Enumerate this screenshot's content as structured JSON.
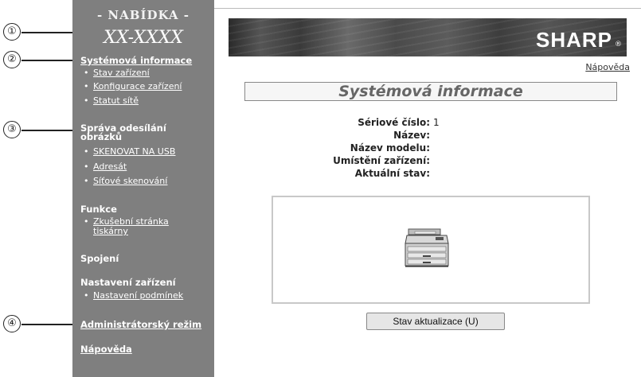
{
  "callouts": [
    "①",
    "②",
    "③",
    "④"
  ],
  "sidebar": {
    "menu_title": "- NABÍDKA -",
    "model": "XX-XXXX",
    "sections": [
      {
        "label": "Systémová informace",
        "items": [
          "Stav zařízení",
          "Konfigurace zařízení",
          "Statut sítě"
        ]
      },
      {
        "label_line1": "Správa odesílání",
        "label_line2": "obrázků",
        "items": [
          "SKENOVAT NA USB",
          "Adresát",
          "Síťové skenování"
        ]
      },
      {
        "label": "Funkce",
        "items_line1": "Zkušební stránka",
        "items_line2": "tiskárny"
      },
      {
        "label": "Spojení"
      },
      {
        "label": "Nastavení zařízení",
        "items": [
          "Nastavení podmínek"
        ]
      },
      {
        "label": "Administrátorský režim"
      },
      {
        "label": "Nápověda"
      }
    ]
  },
  "header": {
    "logo": "SHARP",
    "help_link": "Nápověda"
  },
  "main": {
    "title": "Systémová informace",
    "info": [
      {
        "label": "Sériové číslo:",
        "value": "1"
      },
      {
        "label": "Název:",
        "value": ""
      },
      {
        "label": "Název modelu:",
        "value": ""
      },
      {
        "label": "Umístění zařízení:",
        "value": ""
      },
      {
        "label": "Aktuální stav:",
        "value": ""
      }
    ],
    "update_button": "Stav aktualizace (U)"
  },
  "icons": {
    "device": "copier-printer-icon",
    "registered": "registered-mark-icon"
  },
  "colors": {
    "sidebar_bg": "#7f7f7f",
    "title_text": "#666666"
  }
}
